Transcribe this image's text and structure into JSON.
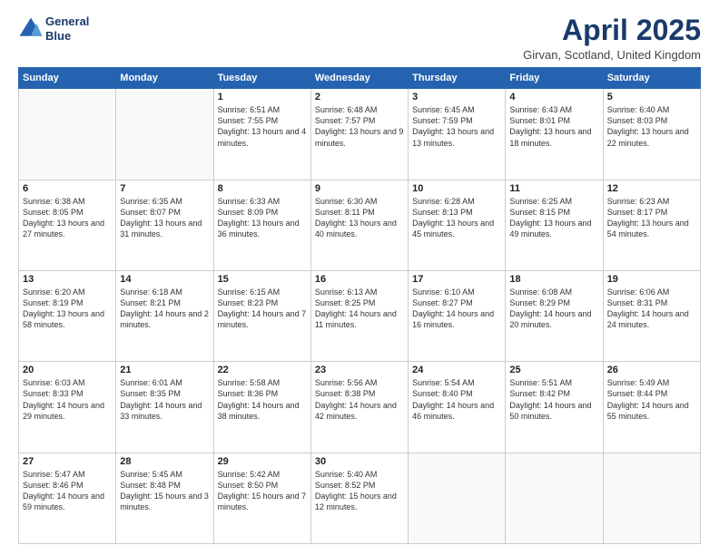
{
  "logo": {
    "line1": "General",
    "line2": "Blue"
  },
  "title": "April 2025",
  "subtitle": "Girvan, Scotland, United Kingdom",
  "days_of_week": [
    "Sunday",
    "Monday",
    "Tuesday",
    "Wednesday",
    "Thursday",
    "Friday",
    "Saturday"
  ],
  "weeks": [
    [
      {
        "day": "",
        "info": ""
      },
      {
        "day": "",
        "info": ""
      },
      {
        "day": "1",
        "info": "Sunrise: 6:51 AM\nSunset: 7:55 PM\nDaylight: 13 hours and 4 minutes."
      },
      {
        "day": "2",
        "info": "Sunrise: 6:48 AM\nSunset: 7:57 PM\nDaylight: 13 hours and 9 minutes."
      },
      {
        "day": "3",
        "info": "Sunrise: 6:45 AM\nSunset: 7:59 PM\nDaylight: 13 hours and 13 minutes."
      },
      {
        "day": "4",
        "info": "Sunrise: 6:43 AM\nSunset: 8:01 PM\nDaylight: 13 hours and 18 minutes."
      },
      {
        "day": "5",
        "info": "Sunrise: 6:40 AM\nSunset: 8:03 PM\nDaylight: 13 hours and 22 minutes."
      }
    ],
    [
      {
        "day": "6",
        "info": "Sunrise: 6:38 AM\nSunset: 8:05 PM\nDaylight: 13 hours and 27 minutes."
      },
      {
        "day": "7",
        "info": "Sunrise: 6:35 AM\nSunset: 8:07 PM\nDaylight: 13 hours and 31 minutes."
      },
      {
        "day": "8",
        "info": "Sunrise: 6:33 AM\nSunset: 8:09 PM\nDaylight: 13 hours and 36 minutes."
      },
      {
        "day": "9",
        "info": "Sunrise: 6:30 AM\nSunset: 8:11 PM\nDaylight: 13 hours and 40 minutes."
      },
      {
        "day": "10",
        "info": "Sunrise: 6:28 AM\nSunset: 8:13 PM\nDaylight: 13 hours and 45 minutes."
      },
      {
        "day": "11",
        "info": "Sunrise: 6:25 AM\nSunset: 8:15 PM\nDaylight: 13 hours and 49 minutes."
      },
      {
        "day": "12",
        "info": "Sunrise: 6:23 AM\nSunset: 8:17 PM\nDaylight: 13 hours and 54 minutes."
      }
    ],
    [
      {
        "day": "13",
        "info": "Sunrise: 6:20 AM\nSunset: 8:19 PM\nDaylight: 13 hours and 58 minutes."
      },
      {
        "day": "14",
        "info": "Sunrise: 6:18 AM\nSunset: 8:21 PM\nDaylight: 14 hours and 2 minutes."
      },
      {
        "day": "15",
        "info": "Sunrise: 6:15 AM\nSunset: 8:23 PM\nDaylight: 14 hours and 7 minutes."
      },
      {
        "day": "16",
        "info": "Sunrise: 6:13 AM\nSunset: 8:25 PM\nDaylight: 14 hours and 11 minutes."
      },
      {
        "day": "17",
        "info": "Sunrise: 6:10 AM\nSunset: 8:27 PM\nDaylight: 14 hours and 16 minutes."
      },
      {
        "day": "18",
        "info": "Sunrise: 6:08 AM\nSunset: 8:29 PM\nDaylight: 14 hours and 20 minutes."
      },
      {
        "day": "19",
        "info": "Sunrise: 6:06 AM\nSunset: 8:31 PM\nDaylight: 14 hours and 24 minutes."
      }
    ],
    [
      {
        "day": "20",
        "info": "Sunrise: 6:03 AM\nSunset: 8:33 PM\nDaylight: 14 hours and 29 minutes."
      },
      {
        "day": "21",
        "info": "Sunrise: 6:01 AM\nSunset: 8:35 PM\nDaylight: 14 hours and 33 minutes."
      },
      {
        "day": "22",
        "info": "Sunrise: 5:58 AM\nSunset: 8:36 PM\nDaylight: 14 hours and 38 minutes."
      },
      {
        "day": "23",
        "info": "Sunrise: 5:56 AM\nSunset: 8:38 PM\nDaylight: 14 hours and 42 minutes."
      },
      {
        "day": "24",
        "info": "Sunrise: 5:54 AM\nSunset: 8:40 PM\nDaylight: 14 hours and 46 minutes."
      },
      {
        "day": "25",
        "info": "Sunrise: 5:51 AM\nSunset: 8:42 PM\nDaylight: 14 hours and 50 minutes."
      },
      {
        "day": "26",
        "info": "Sunrise: 5:49 AM\nSunset: 8:44 PM\nDaylight: 14 hours and 55 minutes."
      }
    ],
    [
      {
        "day": "27",
        "info": "Sunrise: 5:47 AM\nSunset: 8:46 PM\nDaylight: 14 hours and 59 minutes."
      },
      {
        "day": "28",
        "info": "Sunrise: 5:45 AM\nSunset: 8:48 PM\nDaylight: 15 hours and 3 minutes."
      },
      {
        "day": "29",
        "info": "Sunrise: 5:42 AM\nSunset: 8:50 PM\nDaylight: 15 hours and 7 minutes."
      },
      {
        "day": "30",
        "info": "Sunrise: 5:40 AM\nSunset: 8:52 PM\nDaylight: 15 hours and 12 minutes."
      },
      {
        "day": "",
        "info": ""
      },
      {
        "day": "",
        "info": ""
      },
      {
        "day": "",
        "info": ""
      }
    ]
  ]
}
